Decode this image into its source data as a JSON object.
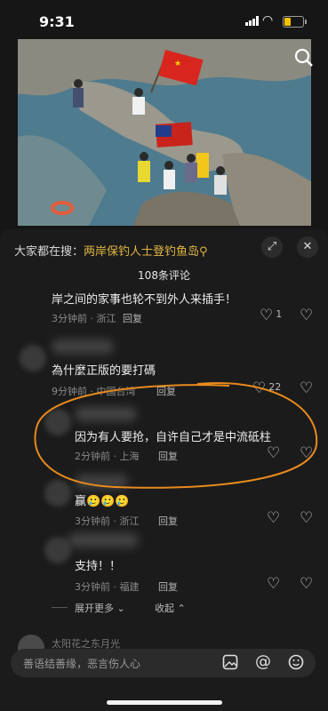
{
  "status": {
    "time": "9:31",
    "battery_level": 0.35
  },
  "header": {
    "hot_prefix": "大家都在搜：",
    "hot_keyword": "两岸保钓人士登钓鱼岛",
    "hot_icon": "search-small-icon",
    "comment_count": "108条评论"
  },
  "comments": [
    {
      "text": "岸之间的家事也轮不到外人来插手！",
      "time": "3分钟前",
      "location": "浙江",
      "reply": "回复",
      "likes": "1"
    },
    {
      "text": "為什麼正版的要打碼",
      "time": "9分钟前",
      "location": "中国台湾",
      "reply": "回复",
      "likes": "22"
    },
    {
      "text": "因为有人要抢，自许自己才是中流砥柱",
      "time": "2分钟前",
      "location": "上海",
      "reply": "回复",
      "likes": ""
    },
    {
      "text": "赢🥲🥲🥲",
      "time": "3分钟前",
      "location": "浙江",
      "reply": "回复",
      "likes": ""
    },
    {
      "text": "支持！！",
      "time": "3分钟前",
      "location": "福建",
      "reply": "回复",
      "likes": ""
    }
  ],
  "more": {
    "expand": "展开更多",
    "collapse": "收起"
  },
  "next_comment_name": "太阳花之东月光",
  "input": {
    "placeholder": "善语结善缘，恶言伤人心"
  },
  "colors": {
    "background": "#161616",
    "keyword": "#e0b640",
    "annotation": "#e88a1e"
  },
  "icons": [
    "search-icon",
    "expand-icon",
    "close-icon",
    "heart-icon",
    "broken-heart-icon",
    "image-icon",
    "at-icon",
    "emoji-icon"
  ]
}
